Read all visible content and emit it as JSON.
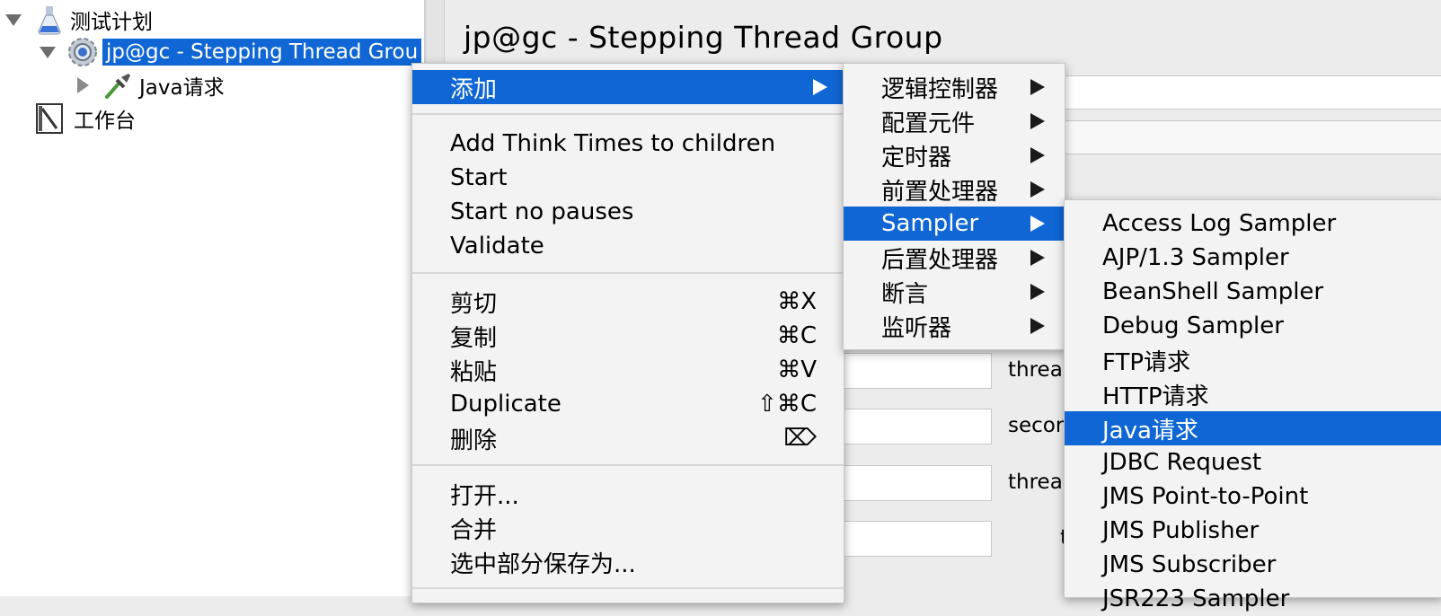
{
  "tree": {
    "root_label": "测试计划",
    "thread_group_label": "jp@gc - Stepping Thread Grou",
    "java_request_label": "Java请求",
    "workbench_label": "工作台"
  },
  "panel": {
    "title": "jp@gc - Stepping Thread Group",
    "partial_labels": [
      "threa",
      "secor",
      "threa",
      "t"
    ]
  },
  "context_menu": {
    "add_label": "添加",
    "group1": [
      "Add Think Times to children",
      "Start",
      "Start no pauses",
      "Validate"
    ],
    "edit_items": [
      {
        "label": "剪切",
        "shortcut": "⌘X"
      },
      {
        "label": "复制",
        "shortcut": "⌘C"
      },
      {
        "label": "粘贴",
        "shortcut": "⌘V"
      },
      {
        "label": "Duplicate",
        "shortcut": "⇧⌘C"
      },
      {
        "label": "删除",
        "shortcut": "⌦"
      }
    ],
    "file_items": [
      "打开...",
      "合并",
      "选中部分保存为..."
    ]
  },
  "add_submenu": [
    "逻辑控制器",
    "配置元件",
    "定时器",
    "前置处理器",
    "Sampler",
    "后置处理器",
    "断言",
    "监听器"
  ],
  "sampler_submenu": [
    "Access Log Sampler",
    "AJP/1.3 Sampler",
    "BeanShell Sampler",
    "Debug Sampler",
    "FTP请求",
    "HTTP请求",
    "Java请求",
    "JDBC Request",
    "JMS Point-to-Point",
    "JMS Publisher",
    "JMS Subscriber",
    "JSR223 Sampler"
  ],
  "colors": {
    "selection": "#0f66d4",
    "menu_bg": "#f3f3f3"
  }
}
